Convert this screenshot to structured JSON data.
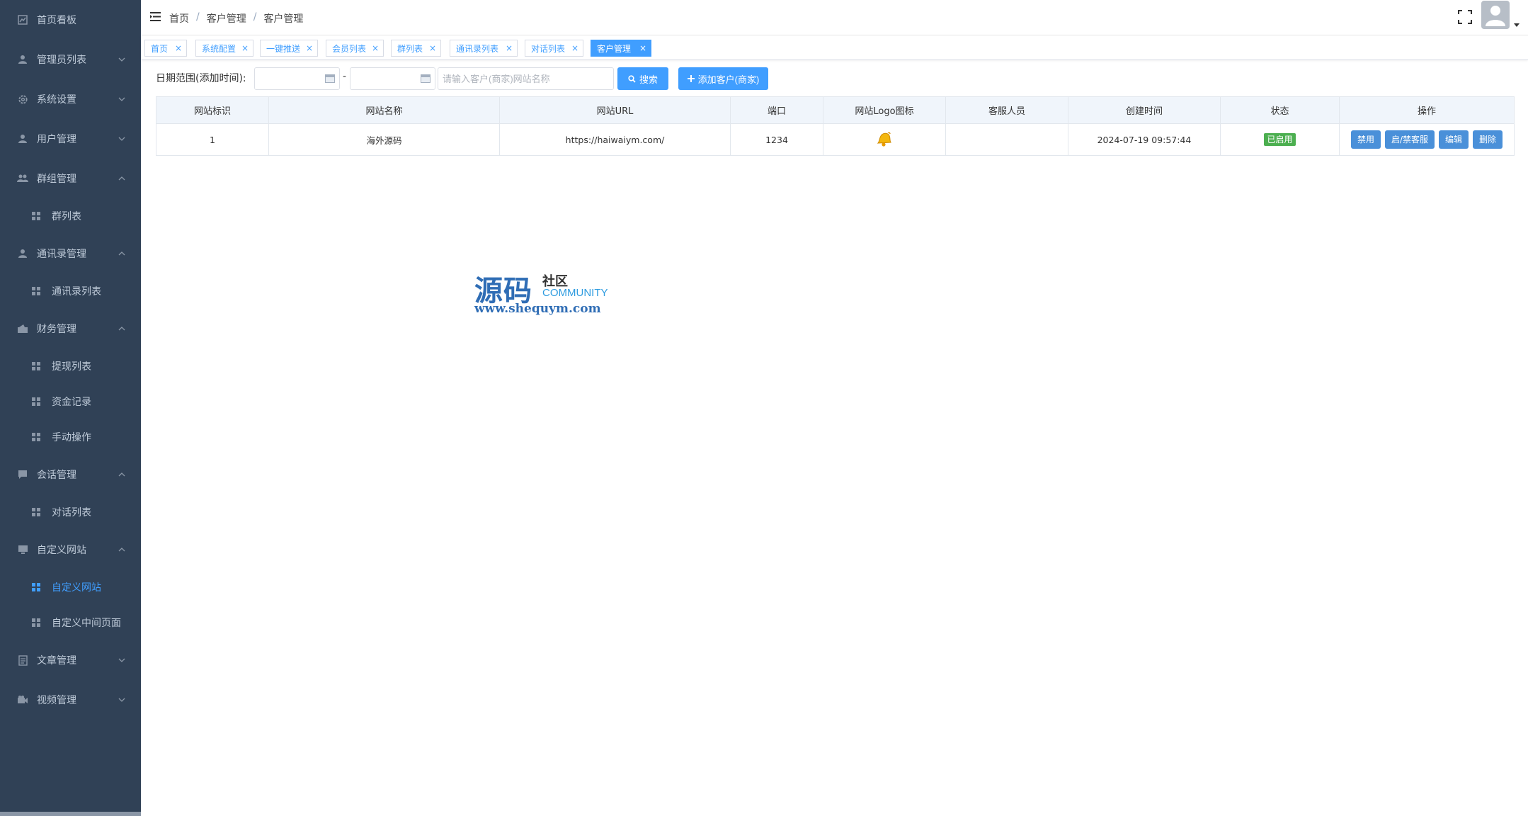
{
  "sidebar": {
    "items": [
      {
        "label": "首页看板",
        "icon": "chart-icon",
        "arrow": "none"
      },
      {
        "label": "管理员列表",
        "icon": "user-icon",
        "arrow": "down"
      },
      {
        "label": "系统设置",
        "icon": "gear-icon",
        "arrow": "down"
      },
      {
        "label": "用户管理",
        "icon": "user-icon",
        "arrow": "down"
      },
      {
        "label": "群组管理",
        "icon": "group-icon",
        "arrow": "up"
      },
      {
        "label": "群列表",
        "icon": "grid-icon",
        "sub": true
      },
      {
        "label": "通讯录管理",
        "icon": "user-icon",
        "arrow": "up"
      },
      {
        "label": "通讯录列表",
        "icon": "grid-icon",
        "sub": true
      },
      {
        "label": "财务管理",
        "icon": "wallet-icon",
        "arrow": "up"
      },
      {
        "label": "提现列表",
        "icon": "grid-icon",
        "sub": true
      },
      {
        "label": "资金记录",
        "icon": "grid-icon",
        "sub": true
      },
      {
        "label": "手动操作",
        "icon": "grid-icon",
        "sub": true
      },
      {
        "label": "会话管理",
        "icon": "chat-icon",
        "arrow": "up"
      },
      {
        "label": "对话列表",
        "icon": "grid-icon",
        "sub": true
      },
      {
        "label": "自定义网站",
        "icon": "monitor-icon",
        "arrow": "up"
      },
      {
        "label": "自定义网站",
        "icon": "grid-icon",
        "sub": true,
        "active": true
      },
      {
        "label": "自定义中间页面",
        "icon": "grid-icon",
        "sub": true
      },
      {
        "label": "文章管理",
        "icon": "document-icon",
        "arrow": "down"
      },
      {
        "label": "视频管理",
        "icon": "video-icon",
        "arrow": "down"
      }
    ]
  },
  "header": {
    "breadcrumb": [
      "首页",
      "/",
      "客户管理",
      "/",
      "客户管理"
    ]
  },
  "tags": [
    {
      "label": "首页",
      "close": "×"
    },
    {
      "label": "系统配置",
      "close": "×"
    },
    {
      "label": "一键推送",
      "close": "×"
    },
    {
      "label": "会员列表",
      "close": "×"
    },
    {
      "label": "群列表",
      "close": "×"
    },
    {
      "label": "通讯录列表",
      "close": "×"
    },
    {
      "label": "对话列表",
      "close": "×"
    },
    {
      "label": "客户管理",
      "close": "×",
      "active": true
    }
  ],
  "filter": {
    "label": "日期范围(添加时间):",
    "dash": "-",
    "search_placeholder": "请输入客户(商家)网站名称",
    "search_button": "搜索",
    "add_button": "添加客户(商家)"
  },
  "table": {
    "columns": [
      "网站标识",
      "网站名称",
      "网站URL",
      "端口",
      "网站Logo图标",
      "客服人员",
      "创建时间",
      "状态",
      "操作"
    ],
    "rows": [
      {
        "id": "1",
        "name": "海外源码",
        "url": "https://haiwaiym.com/",
        "port": "1234",
        "logo": "bell-icon",
        "staff": "",
        "created": "2024-07-19 09:57:44",
        "status": "已启用",
        "actions": [
          "禁用",
          "启/禁客服",
          "编辑",
          "删除"
        ]
      }
    ]
  },
  "watermark": {
    "big": "源码",
    "small1": "社区",
    "small2": "COMMUNITY",
    "url": "www.shequym.com"
  },
  "colors": {
    "sidebar_bg": "#304156",
    "accent": "#409eff",
    "status_green": "#4caf50"
  }
}
